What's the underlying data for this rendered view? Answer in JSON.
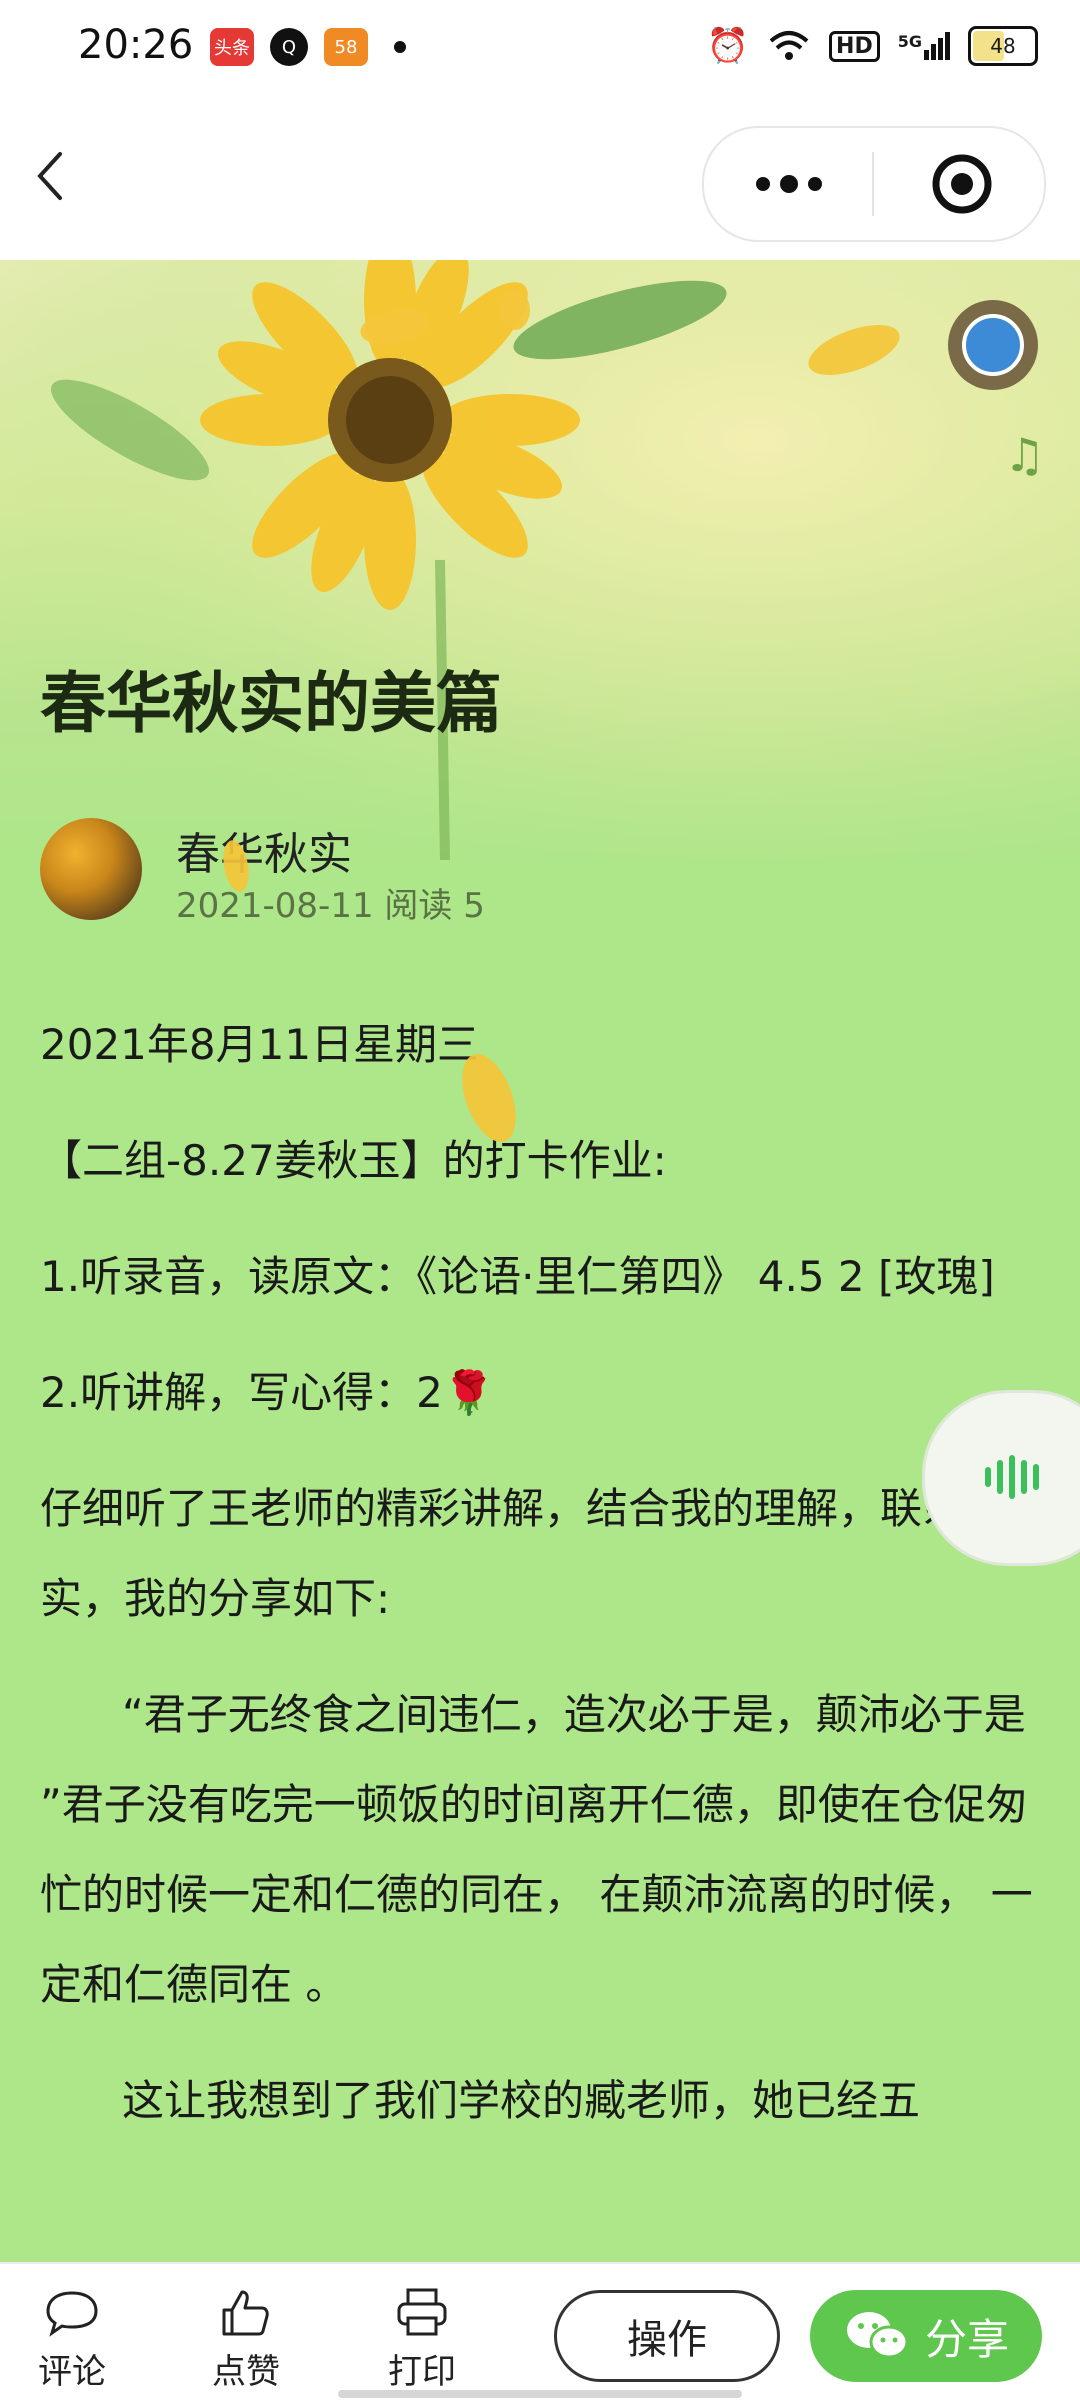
{
  "status_bar": {
    "time": "20:26",
    "apps": [
      {
        "icon": "toutiao-icon",
        "label": "头条",
        "color": "#e53935"
      },
      {
        "icon": "search-q-icon",
        "label": "Q",
        "color": "#111111"
      },
      {
        "icon": "app-58-icon",
        "label": "58",
        "color": "#f08a24"
      }
    ],
    "hd": "HD",
    "network": "5G",
    "battery": "48"
  },
  "nav": {
    "back_icon": "chevron-left-icon",
    "more_icon": "more-dots-icon",
    "close_icon": "target-icon"
  },
  "hero": {
    "title": "春华秋实的美篇"
  },
  "author": {
    "name": "春华秋实",
    "meta": "2021-08-11 阅读 5"
  },
  "article": {
    "paragraphs": [
      "2021年8月11日星期三",
      "【二组-8.27姜秋玉】的打卡作业:",
      "1.听录音，读原文：《论语·里仁第四》 4.5 2 [玫瑰]",
      "2.听讲解，写心得：2🌹",
      "仔细听了王老师的精彩讲解，结合我的理解，联系现实，我的分享如下:",
      "“君子无终食之间违仁，造次必于是，颠沛必于是 ”君子没有吃完一顿饭的时间离开仁德，即使在仓促匆忙的时候一定和仁德的同在， 在颠沛流离的时候， 一定和仁德同在 。",
      "这让我想到了我们学校的臧老师，她已经五"
    ]
  },
  "toolbar": {
    "comment": "评论",
    "like": "点赞",
    "print": "打印",
    "operate": "操作",
    "share": "分享"
  },
  "colors": {
    "page_bg": "#aee68a",
    "share_green": "#5fc64e",
    "voice_green": "#3bbf5a"
  }
}
